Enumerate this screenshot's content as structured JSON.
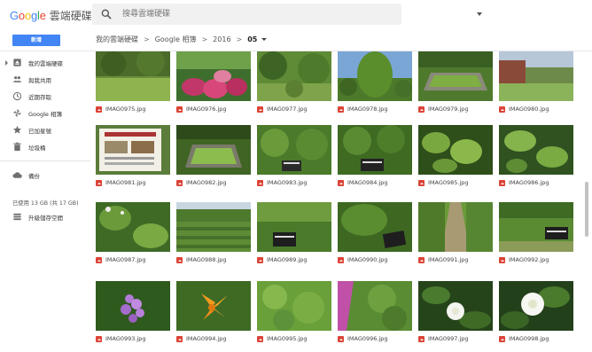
{
  "header": {
    "logo_google": "Google",
    "logo_product": "雲端硬碟",
    "search_placeholder": "搜尋雲端硬碟",
    "search_icon": "search-icon",
    "search_options_icon": "dropdown-icon"
  },
  "toolbar": {
    "new_label": "新增",
    "new_color": "#4285f4",
    "breadcrumb": [
      "我的雲端硬碟",
      "Google 相簿",
      "2016",
      "05"
    ],
    "breadcrumb_sep": ">"
  },
  "sidebar": {
    "items": [
      {
        "label": "我的雲端硬碟",
        "icon": "drive-folder-icon"
      },
      {
        "label": "與我共用",
        "icon": "people-icon"
      },
      {
        "label": "近期存取",
        "icon": "clock-icon"
      },
      {
        "label": "Google 相簿",
        "icon": "pinwheel-icon"
      },
      {
        "label": "已加星號",
        "icon": "star-icon"
      },
      {
        "label": "垃圾桶",
        "icon": "trash-icon"
      },
      {
        "label": "備份",
        "icon": "cloud-icon"
      },
      {
        "label": "升級儲存空間",
        "icon": "storage-icon"
      }
    ],
    "storage_text": "已使用 13 GB (共 17 GB)"
  },
  "files": [
    {
      "name": "IMAG0975.jpg"
    },
    {
      "name": "IMAG0976.jpg"
    },
    {
      "name": "IMAG0977.jpg"
    },
    {
      "name": "IMAG0978.jpg"
    },
    {
      "name": "IMAG0979.jpg"
    },
    {
      "name": "IMAG0980.jpg"
    },
    {
      "name": "IMAG0981.jpg"
    },
    {
      "name": "IMAG0982.jpg"
    },
    {
      "name": "IMAG0983.jpg"
    },
    {
      "name": "IMAG0984.jpg"
    },
    {
      "name": "IMAG0985.jpg"
    },
    {
      "name": "IMAG0986.jpg"
    },
    {
      "name": "IMAG0987.jpg"
    },
    {
      "name": "IMAG0988.jpg"
    },
    {
      "name": "IMAG0989.jpg"
    },
    {
      "name": "IMAG0990.jpg"
    },
    {
      "name": "IMAG0991.jpg"
    },
    {
      "name": "IMAG0992.jpg"
    },
    {
      "name": "IMAG0993.jpg"
    },
    {
      "name": "IMAG0994.jpg"
    },
    {
      "name": "IMAG0995.jpg"
    },
    {
      "name": "IMAG0996.jpg"
    },
    {
      "name": "IMAG0997.jpg"
    },
    {
      "name": "IMAG0998.jpg"
    }
  ],
  "file_type_icon": "image-file-icon",
  "file_type_color": "#db4437"
}
